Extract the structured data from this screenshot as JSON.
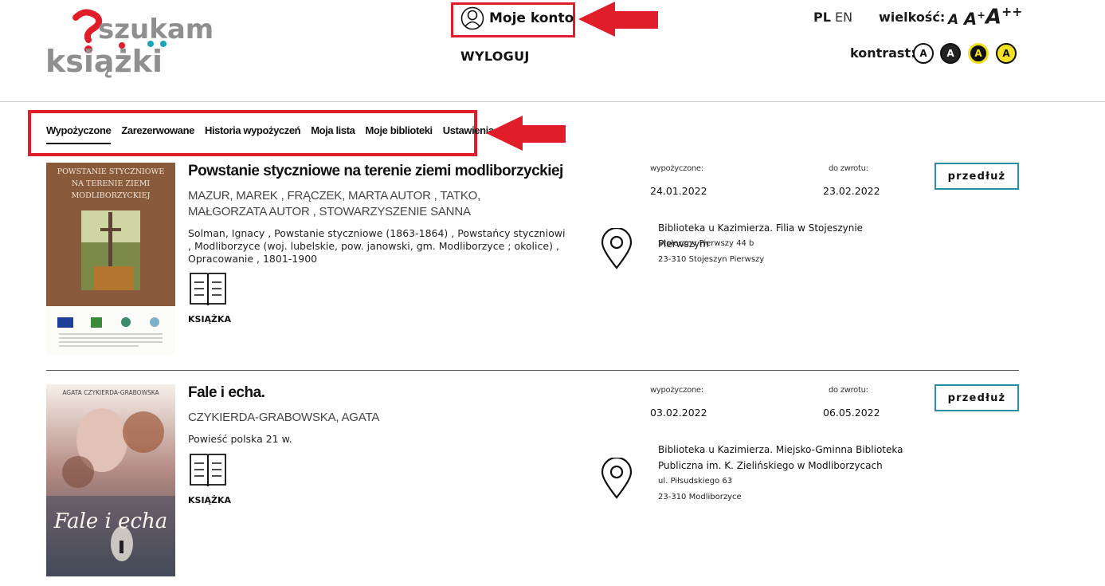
{
  "logo": {
    "line1": "szukam",
    "line2": "książki"
  },
  "header": {
    "account_label": "Moje konto",
    "logout_label": "WYLOGUJ",
    "lang_pl": "PL",
    "lang_en": "EN",
    "size_label": "wielkość:",
    "size_options": [
      "A",
      "A",
      "A"
    ],
    "size_sups": [
      "+",
      "++"
    ],
    "contrast_label": "kontrast:",
    "contrast_options": [
      "A",
      "A",
      "A",
      "A"
    ]
  },
  "tabs": [
    {
      "label": "Wypożyczone",
      "active": true
    },
    {
      "label": "Zarezerwowane"
    },
    {
      "label": "Historia wypożyczeń"
    },
    {
      "label": "Moja lista"
    },
    {
      "label": "Moje biblioteki"
    },
    {
      "label": "Ustawienia"
    }
  ],
  "items": [
    {
      "cover_text": "POWSTANIE STYCZNIOWE NA TERENIE ZIEMI MODLIBORZYCKIEJ",
      "title": "Powstanie styczniowe na terenie ziemi modliborzyckiej",
      "authors": "MAZUR, MAREK , FRĄCZEK, MARTA AUTOR , TATKO, MAŁGORZATA AUTOR , STOWARZYSZENIE SANNA",
      "subjects": "Solman, Ignacy , Powstanie styczniowe (1863-1864) , Powstańcy styczniowi , Modliborzyce (woj. lubelskie, pow. janowski, gm. Modliborzyce ; okolice) , Opracowanie , 1801-1900",
      "type": "KSIĄŻKA",
      "borrowed_label": "wypożyczone:",
      "due_label": "do zwrotu:",
      "borrowed_date": "24.01.2022",
      "due_date": "23.02.2022",
      "extend_label": "przedłuż",
      "library_name": "Biblioteka u Kazimierza. Filia w Stojeszynie Pierwszym",
      "address1": "Stołeczny Pierwszy 44 b",
      "address2": "23-310 Stojeszyn Pierwszy"
    },
    {
      "cover_author": "AGATA CZYKIERDA-GRABOWSKA",
      "cover_title": "Fale i echa",
      "title": "Fale i echa.",
      "authors": "CZYKIERDA-GRABOWSKA, AGATA",
      "subjects": "Powieść polska 21 w.",
      "type": "KSIĄŻKA",
      "borrowed_label": "wypożyczone:",
      "due_label": "do zwrotu:",
      "borrowed_date": "03.02.2022",
      "due_date": "06.05.2022",
      "extend_label": "przedłuż",
      "library_name": "Biblioteka u Kazimierza. Miejsko-Gminna Biblioteka Publiczna im. K. Zielińskiego w Modliborzycach",
      "address1": "ul. Piłsudskiego 63",
      "address2": "23-310 Modliborzyce"
    }
  ],
  "colors": {
    "highlight_red": "#e11d2a",
    "button_border": "#2a8fa5",
    "contrast_yellow": "#f3e221"
  }
}
